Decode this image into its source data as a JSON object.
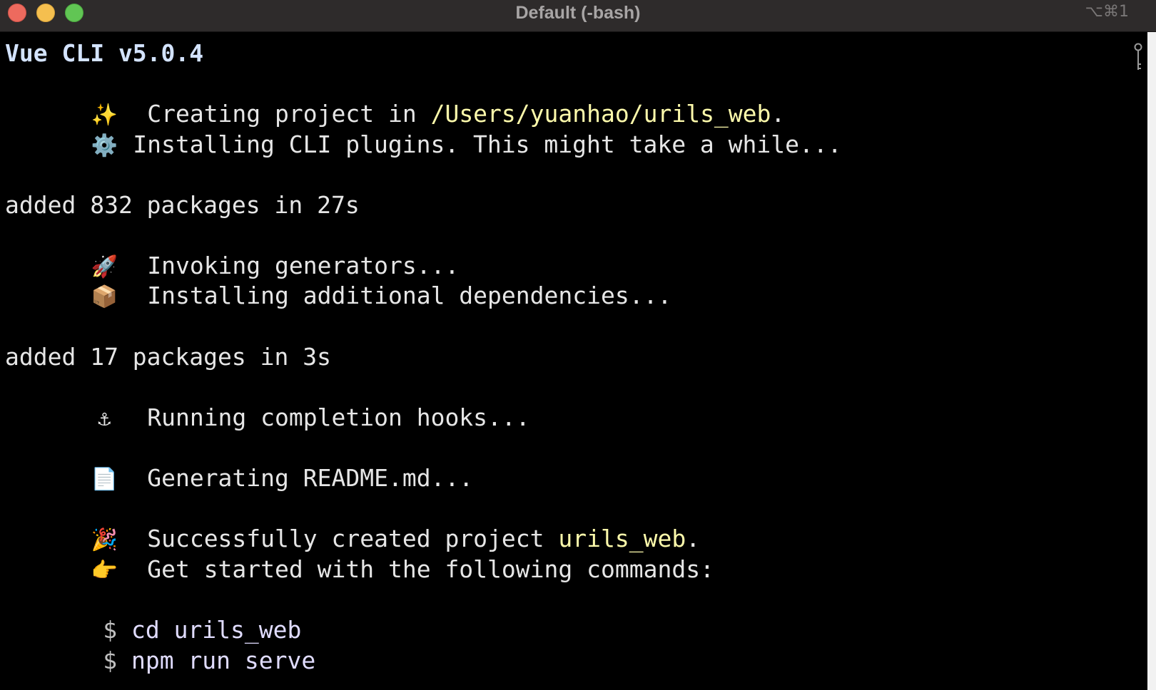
{
  "window": {
    "title": "Default (-bash)",
    "shortcut": "⌥⌘1"
  },
  "icons": {
    "sparkles": "✨",
    "gear": "⚙️",
    "rocket": "🚀",
    "package": "📦",
    "anchor": "⚓",
    "document": "📄",
    "party": "🎉",
    "pointing": "👉"
  },
  "terminal": {
    "header": "Vue CLI v5.0.4",
    "creating_prefix": "Creating project in ",
    "creating_path": "/Users/yuanhao/urils_web",
    "creating_suffix": ".",
    "installing_plugins": "Installing CLI plugins. This might take a while...",
    "added_1": "added 832 packages in 27s",
    "invoking": "Invoking generators...",
    "installing_deps": "Installing additional dependencies...",
    "added_2": "added 17 packages in 3s",
    "completion_hooks": "Running completion hooks...",
    "readme": "Generating README.md...",
    "success_prefix": "Successfully created project ",
    "success_project": "urils_web",
    "success_suffix": ".",
    "get_started": "Get started with the following commands:",
    "prompt": "$",
    "commands": [
      "cd urils_web",
      "npm run serve"
    ]
  },
  "colors": {
    "background": "#000000",
    "text": "#e6e6e6",
    "highlight_yellow": "#fdfaab",
    "header_blue": "#d3e3ff",
    "titlebar": "#2e2b2b"
  }
}
